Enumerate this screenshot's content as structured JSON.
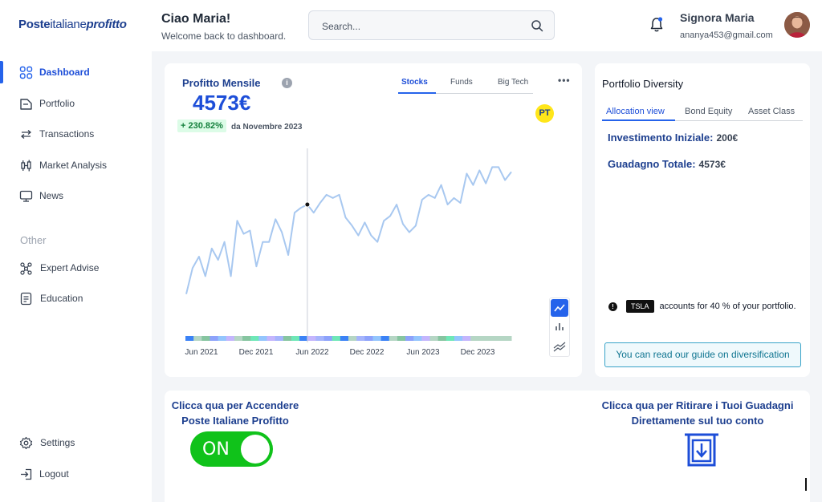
{
  "app": {
    "logo": {
      "part1": "Poste",
      "part2": "italiane",
      "part3": "profitto"
    }
  },
  "header": {
    "greeting": "Ciao Maria!",
    "subtitle": "Welcome back to dashboard.",
    "search_placeholder": "Search...",
    "user_name": "Signora Maria",
    "user_email": "ananya453@gmail.com"
  },
  "sidebar": {
    "items": [
      {
        "label": "Dashboard",
        "icon": "dashboard-grid-icon"
      },
      {
        "label": "Portfolio",
        "icon": "portfolio-icon"
      },
      {
        "label": "Transactions",
        "icon": "transactions-arrows-icon"
      },
      {
        "label": "Market Analysis",
        "icon": "candlestick-icon"
      },
      {
        "label": "News",
        "icon": "monitor-icon"
      }
    ],
    "section_other": "Other",
    "other_items": [
      {
        "label": "Expert Advise",
        "icon": "network-icon"
      },
      {
        "label": "Education",
        "icon": "document-icon"
      }
    ],
    "settings_label": "Settings",
    "logout_label": "Logout"
  },
  "profit_card": {
    "title": "Profitto Mensile",
    "value": "4573€",
    "change": "+ 230.82%",
    "since": "da Novembre 2023",
    "tabs": [
      "Stocks",
      "Funds",
      "Big Tech"
    ],
    "active_tab": "Stocks",
    "more": "•••",
    "badge": "PT"
  },
  "chart_data": {
    "type": "line",
    "x_tick_labels": [
      "Jun 2021",
      "Dec 2021",
      "Jun 2022",
      "Dec 2022",
      "Jun 2023",
      "Dec 2023"
    ],
    "series": [
      {
        "values": [
          10,
          26,
          33,
          21,
          38,
          31,
          42,
          21,
          55,
          47,
          49,
          27,
          42,
          42,
          56,
          48,
          34,
          60,
          63,
          65,
          60,
          66,
          71,
          69,
          71,
          57,
          52,
          46,
          54,
          46,
          42,
          55,
          58,
          65,
          53,
          48,
          52,
          68,
          71,
          69,
          77,
          65,
          69,
          66,
          84,
          77,
          86,
          78,
          88,
          88,
          80,
          85
        ]
      }
    ],
    "crosshair_index": 19,
    "line_color": "#a8c8f0"
  },
  "diversity_card": {
    "title": "Portfolio Diversity",
    "tabs": [
      "Allocation view",
      "Bond Equity",
      "Asset Class"
    ],
    "active_tab": "Allocation view",
    "invest_label": "Investimento Iniziale:",
    "invest_value": "200€",
    "gain_label": "Guadagno Totale:",
    "gain_value": "4573€",
    "warn_icon": "!",
    "tsla_badge": "TSLA",
    "tsla_text": "accounts for 40 % of your portfolio.",
    "guide_button": "You can read our guide on diversification"
  },
  "bottom_card": {
    "left_text_line1": "Clicca qua per Accendere",
    "left_text_line2": "Poste Italiane Profitto",
    "toggle_label": "ON",
    "right_text_line1": "Clicca qua per Ritirare i Tuoi Guadagni",
    "right_text_line2": "Direttamente sul tuo conto"
  },
  "colors": {
    "brand_blue": "#1d3f8f",
    "accent_blue": "#2563eb",
    "toggle_green": "#10c21a",
    "positive_green": "#15803d"
  }
}
